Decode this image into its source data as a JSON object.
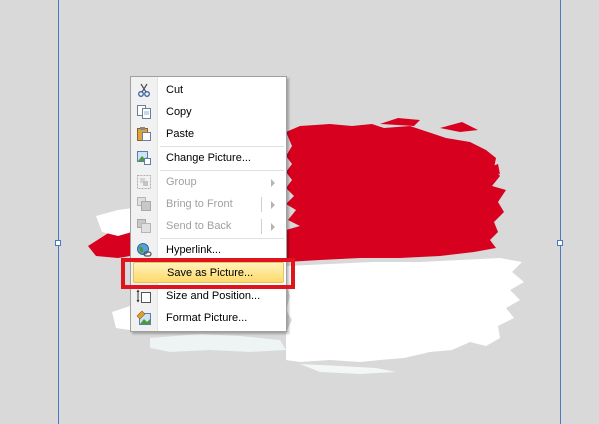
{
  "colors": {
    "canvas_bg": "#d9d9d9",
    "flag_red": "#d8001f",
    "flag_white": "#ffffff",
    "highlight_box": "#e0141c",
    "menu_highlight": "#ffd96a"
  },
  "context_menu": {
    "items": [
      {
        "label": "Cut",
        "icon": "scissors-icon",
        "enabled": true
      },
      {
        "label": "Copy",
        "icon": "copy-icon",
        "enabled": true
      },
      {
        "label": "Paste",
        "icon": "paste-icon",
        "enabled": true
      },
      {
        "label": "Change Picture...",
        "icon": "change-picture-icon",
        "enabled": true
      },
      {
        "label": "Group",
        "icon": "group-icon",
        "enabled": false,
        "submenu": true
      },
      {
        "label": "Bring to Front",
        "icon": "bring-to-front-icon",
        "enabled": false,
        "submenu": true
      },
      {
        "label": "Send to Back",
        "icon": "send-to-back-icon",
        "enabled": false,
        "submenu": true
      },
      {
        "label": "Hyperlink...",
        "icon": "hyperlink-globe-icon",
        "enabled": true
      },
      {
        "label": "Save as Picture...",
        "icon": "",
        "enabled": true,
        "highlighted": true
      },
      {
        "label": "Size and Position...",
        "icon": "size-position-icon",
        "enabled": true
      },
      {
        "label": "Format Picture...",
        "icon": "format-picture-icon",
        "enabled": true
      }
    ]
  }
}
